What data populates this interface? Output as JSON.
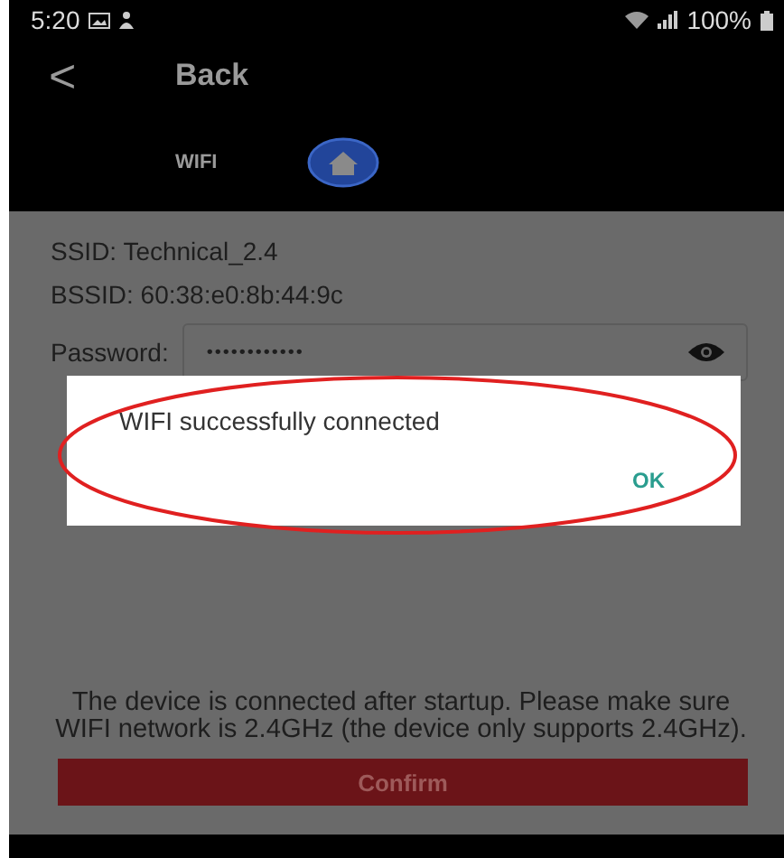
{
  "status_bar": {
    "time": "5:20",
    "battery": "100%"
  },
  "header": {
    "back": "<",
    "title": "Back"
  },
  "tab_row": {
    "label": "WIFI"
  },
  "ssid": "SSID: Technical_2.4",
  "bssid": "BSSID: 60:38:e0:8b:44:9c",
  "password": {
    "label": "Password:",
    "value": "••••••••••••"
  },
  "notice": "The device is connected after startup. Please make sure WIFI network is 2.4GHz (the device only supports 2.4GHz).",
  "confirm_button": "Confirm",
  "dialog": {
    "message": "WIFI successfully connected",
    "ok": "OK"
  }
}
